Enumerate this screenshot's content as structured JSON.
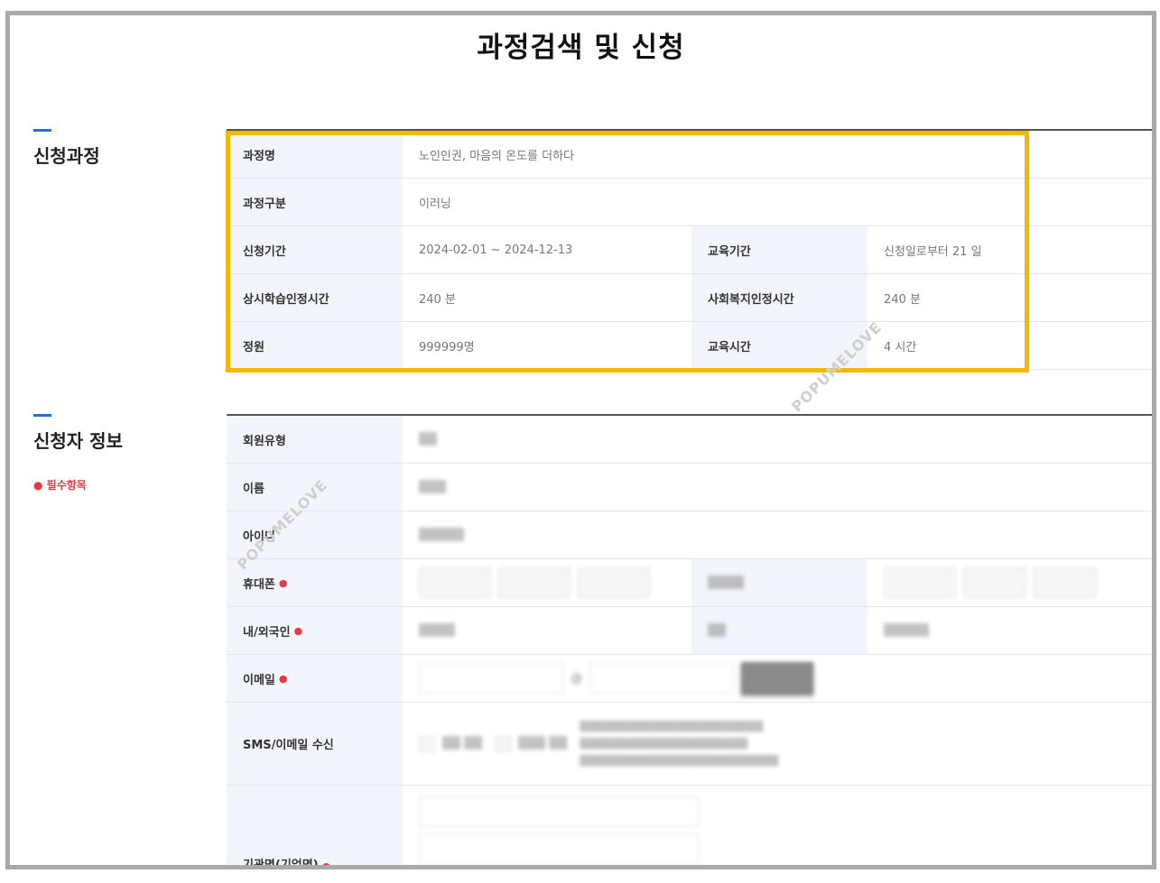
{
  "page_title": "과정검색 및 신청",
  "sections": {
    "course": {
      "title": "신청과정"
    },
    "applicant": {
      "title": "신청자 정보",
      "required_note": "● 필수항목"
    }
  },
  "course_table": {
    "course_name_label": "과정명",
    "course_name_value": "노인인권, 마음의 온도를 더하다",
    "course_type_label": "과정구분",
    "course_type_value": "이러닝",
    "apply_period_label": "신청기간",
    "apply_period_value": "2024-02-01 ~ 2024-12-13",
    "edu_period_label": "교육기간",
    "edu_period_value": "신청일로부터 21 일",
    "regular_learning_label": "상시학습인정시간",
    "regular_learning_value": "240 분",
    "social_welfare_label": "사회복지인정시간",
    "social_welfare_value": "240 분",
    "capacity_label": "정원",
    "capacity_value": "999999명",
    "edu_hours_label": "교육시간",
    "edu_hours_value": "4 시간"
  },
  "applicant_table": {
    "member_type_label": "회원유형",
    "name_label": "이름",
    "id_label": "아이디",
    "mobile_label": "휴대폰",
    "nationality_label": "내/외국인",
    "email_label": "이메일",
    "sms_label": "SMS/이메일 수신",
    "org_label": "기관명(기업명)"
  },
  "watermark": "POPUMELOVE",
  "colors": {
    "highlight": "#f5b700",
    "accent": "#1f6fd6",
    "required": "#e63946"
  }
}
